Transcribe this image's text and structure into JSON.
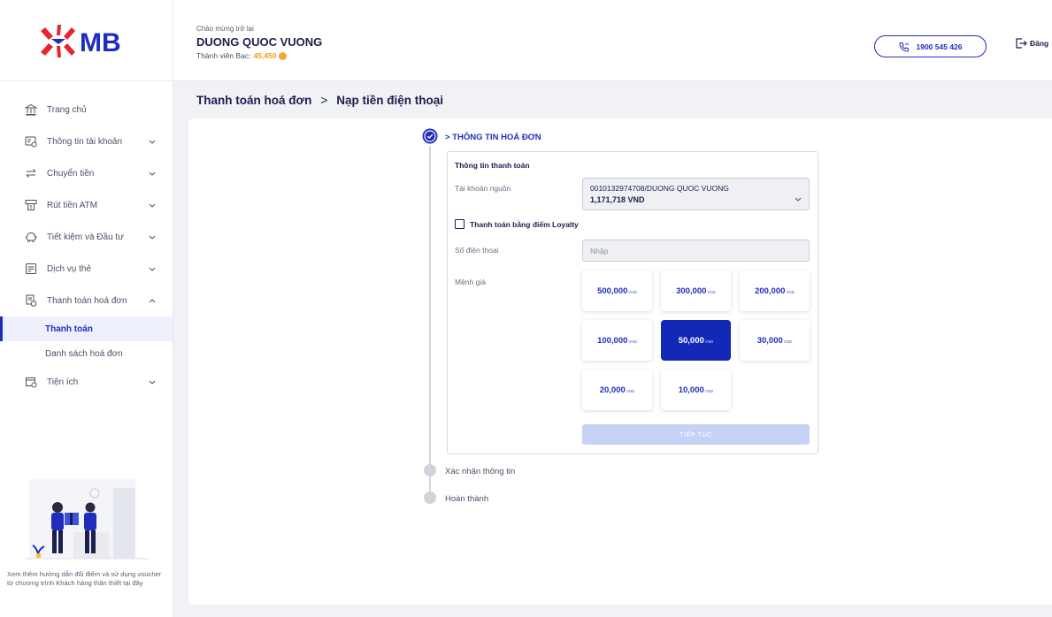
{
  "brand": {
    "logo_text": "MB",
    "accent": "#1e2dbd",
    "logo_red": "#e8242c"
  },
  "header": {
    "greeting": "Chào mừng trở lại",
    "user_name": "DUONG QUOC VUONG",
    "member_label": "Thành viên Bạc:",
    "member_points": "45,450",
    "hotline": "1900 545 426",
    "logout_label": "Đăng"
  },
  "sidebar": {
    "items": [
      {
        "label": "Trang chủ",
        "icon": "bank-icon",
        "has_chevron": false
      },
      {
        "label": "Thông tin tài khoản",
        "icon": "account-card-icon",
        "has_chevron": true
      },
      {
        "label": "Chuyển tiền",
        "icon": "transfer-icon",
        "has_chevron": true
      },
      {
        "label": "Rút tiền ATM",
        "icon": "atm-icon",
        "has_chevron": true
      },
      {
        "label": "Tiết kiệm và Đầu tư",
        "icon": "piggy-bank-icon",
        "has_chevron": true
      },
      {
        "label": "Dịch vụ thẻ",
        "icon": "card-icon",
        "has_chevron": true
      },
      {
        "label": "Thanh toán hoá đơn",
        "icon": "bill-icon",
        "has_chevron": true,
        "expanded": true
      },
      {
        "label": "Tiện ích",
        "icon": "utility-icon",
        "has_chevron": true
      }
    ],
    "sub_items": [
      {
        "label": "Thanh toán",
        "active": true
      },
      {
        "label": "Danh sách hoá đơn",
        "active": false
      }
    ],
    "promo_text": "Xem thêm hướng dẫn đổi điểm và sử dụng voucher từ chương trình Khách hàng thân thiết tại đây"
  },
  "breadcrumb": {
    "parent": "Thanh toán hoá đơn",
    "separator": ">",
    "current": "Nạp tiền điện thoại"
  },
  "steps": [
    {
      "label": "> THÔNG TIN HOÁ ĐƠN",
      "state": "active"
    },
    {
      "label": "Xác nhận thông tin",
      "state": "pending"
    },
    {
      "label": "Hoàn thành",
      "state": "pending"
    }
  ],
  "form": {
    "section_title": "Thông tin thanh toán",
    "source_label": "Tài khoản nguồn",
    "source_account": "0010132974708/DUONG QUOC VUONG",
    "source_balance": "1,171,718 VND",
    "loyalty_label": "Thanh toán bằng điểm Loyalty",
    "loyalty_checked": false,
    "phone_label": "Số điện thoại",
    "phone_placeholder": "Nhập",
    "phone_value": "",
    "denom_label": "Mệnh giá",
    "denominations": [
      {
        "value": "500,000",
        "currency": "VND",
        "selected": false
      },
      {
        "value": "300,000",
        "currency": "VND",
        "selected": false
      },
      {
        "value": "200,000",
        "currency": "VND",
        "selected": false
      },
      {
        "value": "100,000",
        "currency": "VND",
        "selected": false
      },
      {
        "value": "50,000",
        "currency": "VND",
        "selected": true
      },
      {
        "value": "30,000",
        "currency": "VND",
        "selected": false
      },
      {
        "value": "20,000",
        "currency": "VND",
        "selected": false
      },
      {
        "value": "10,000",
        "currency": "VND",
        "selected": false
      }
    ],
    "continue_label": "TIẾP TỤC"
  }
}
